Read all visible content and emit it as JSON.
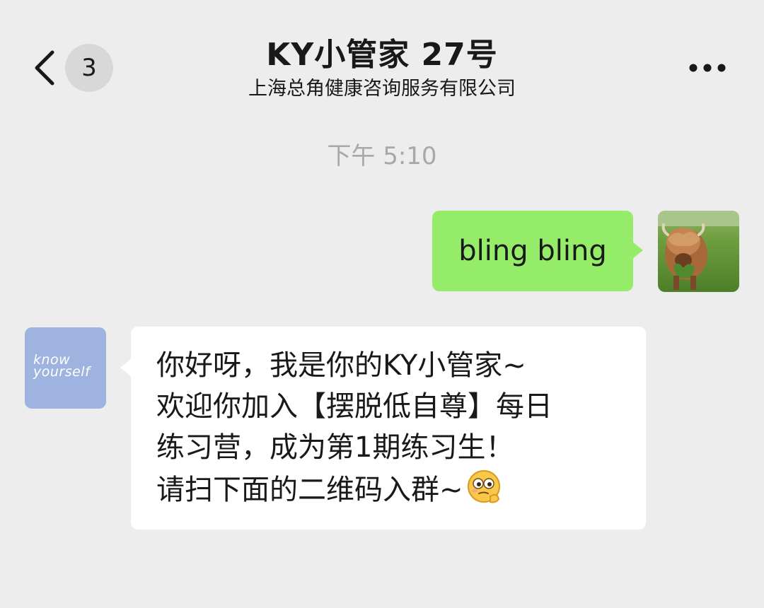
{
  "header": {
    "unread_count": "3",
    "title": "KY小管家 27号",
    "subtitle": "上海总角健康咨询服务有限公司",
    "back_icon": "chevron-left-icon",
    "more_icon": "more-dots-icon"
  },
  "chat": {
    "timestamp": "下午 5:10",
    "messages": [
      {
        "direction": "outgoing",
        "text": "bling bling",
        "bubble_color": "#95ec69",
        "avatar": "highland-cow-photo"
      },
      {
        "direction": "incoming",
        "lines": [
          "你好呀，我是你的KY小管家~",
          "欢迎你加入【摆脱低自尊】每日",
          "练习营，成为第1期练习生！",
          "请扫下面的二维码入群~"
        ],
        "emoji": "thinking-face-emoji",
        "bubble_color": "#ffffff",
        "avatar_text_line1": "know",
        "avatar_text_line2": "yourself",
        "avatar_color": "#9fb3e0"
      }
    ]
  },
  "colors": {
    "background": "#ededed",
    "outgoing_bubble": "#95ec69",
    "incoming_bubble": "#ffffff",
    "timestamp": "#a8a8a8"
  }
}
